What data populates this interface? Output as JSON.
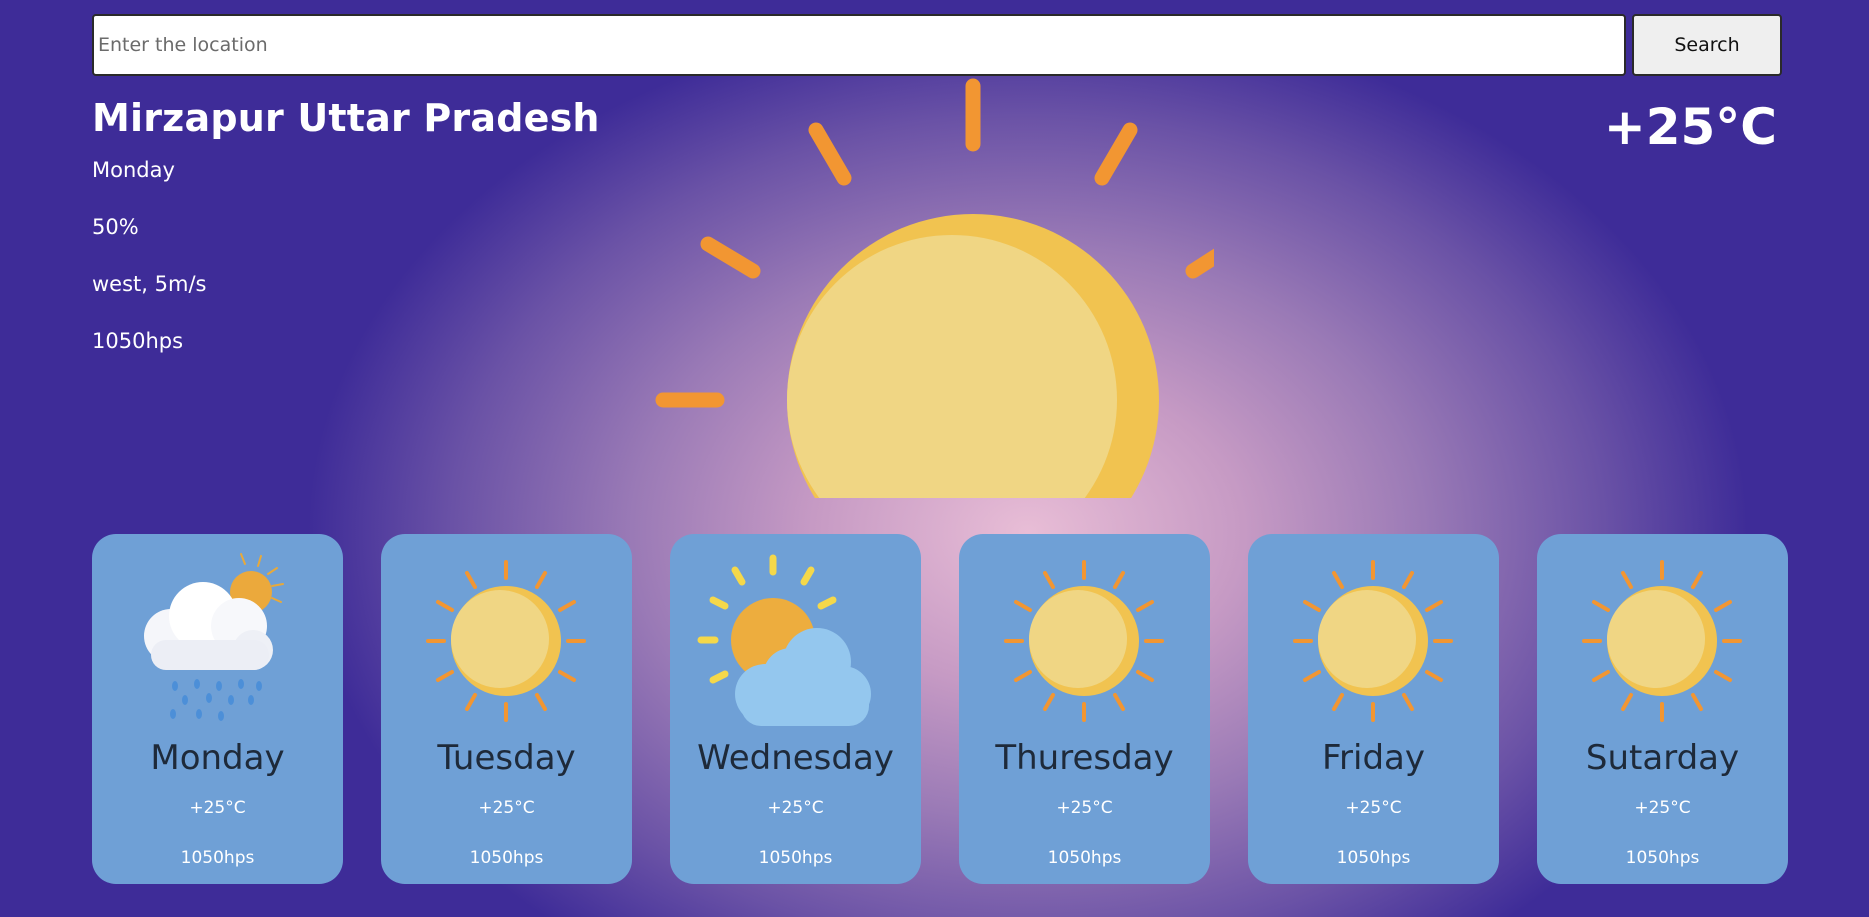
{
  "search": {
    "placeholder": "Enter the location",
    "value": "",
    "button_label": "Search"
  },
  "current": {
    "location": "Mirzapur Uttar Pradesh",
    "day": "Monday",
    "humidity": "50%",
    "wind": "west, 5m/s",
    "pressure": "1050hps",
    "temperature": "+25°C",
    "icon": "sun-icon"
  },
  "forecast": [
    {
      "day": "Monday",
      "temp": "+25°C",
      "pressure": "1050hps",
      "icon": "rain-cloud-sun-icon"
    },
    {
      "day": "Tuesday",
      "temp": "+25°C",
      "pressure": "1050hps",
      "icon": "sun-icon"
    },
    {
      "day": "Wednesday",
      "temp": "+25°C",
      "pressure": "1050hps",
      "icon": "partly-cloudy-icon"
    },
    {
      "day": "Thuresday",
      "temp": "+25°C",
      "pressure": "1050hps",
      "icon": "sun-icon"
    },
    {
      "day": "Friday",
      "temp": "+25°C",
      "pressure": "1050hps",
      "icon": "sun-icon"
    },
    {
      "day": "Sutarday",
      "temp": "+25°C",
      "pressure": "1050hps",
      "icon": "sun-icon"
    }
  ],
  "colors": {
    "card": "#6fa0d6",
    "sun": "#f0d684",
    "sun_shadow": "#f1c350",
    "ray": "#f29632",
    "cloud": "#94c7ee",
    "day_text": "#1e2a3a"
  }
}
